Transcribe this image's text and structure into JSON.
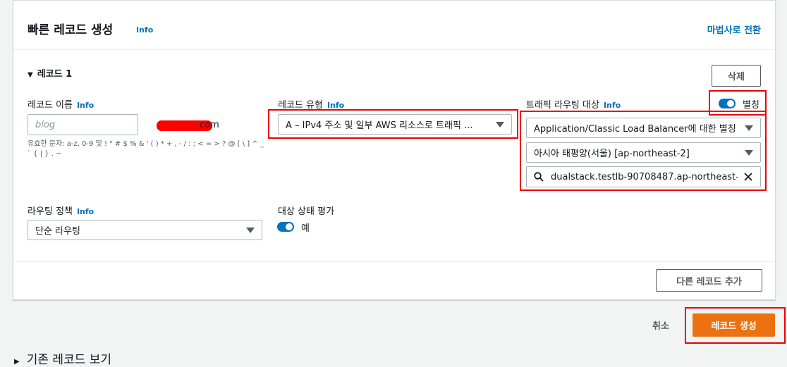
{
  "header": {
    "title": "빠른 레코드 생성",
    "info": "Info",
    "wizard_link": "마법사로 전환"
  },
  "record": {
    "title": "레코드 1",
    "delete_label": "삭제",
    "name": {
      "label": "레코드 이름",
      "info": "Info",
      "placeholder": "blog",
      "suffix": "com",
      "hint": "유효한 문자: a-z, 0-9 및 ! \" # $ % & ' ( ) * + , - / : ; < = > ? @ [ \\ ] ^ _ ` { | } . ~"
    },
    "type": {
      "label": "레코드 유형",
      "info": "Info",
      "value": "A – IPv4 주소 및 일부 AWS 리소스로 트래픽 ..."
    },
    "alias": {
      "label": "트래픽 라우팅 대상",
      "info": "Info",
      "toggle_label": "별칭",
      "toggle_on": true,
      "endpoint": "Application/Classic Load Balancer에 대한 별칭",
      "region": "아시아 태평양(서울) [ap-northeast-2]",
      "lb_value": "dualstack.testlb-90708487.ap-northeast-"
    },
    "routing_policy": {
      "label": "라우팅 정책",
      "info": "Info",
      "value": "단순 라우팅"
    },
    "health_eval": {
      "label": "대상 상태 평가",
      "toggle_label": "예",
      "toggle_on": true
    },
    "add_record_label": "다른 레코드 추가"
  },
  "actions": {
    "cancel": "취소",
    "create": "레코드 생성"
  },
  "existing_records": {
    "label": "기존 레코드 보기"
  },
  "colors": {
    "accent": "#0073bb",
    "primary": "#ec7211",
    "highlight": "#e00000"
  }
}
